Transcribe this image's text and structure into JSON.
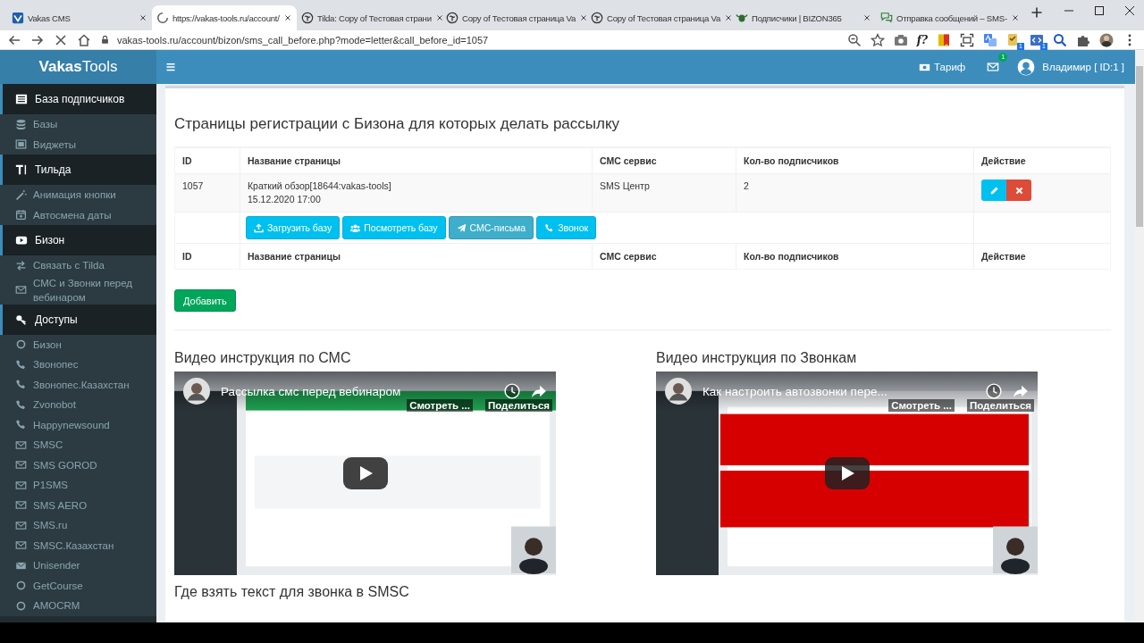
{
  "browser": {
    "tabs": [
      {
        "title": "Vakas CMS",
        "kind": "vakas",
        "selected": false
      },
      {
        "title": "https://vakas-tools.ru/account/",
        "kind": "loading",
        "selected": true
      },
      {
        "title": "Tilda: Copy of Тестовая страни",
        "kind": "tilda",
        "selected": false
      },
      {
        "title": "Copy of Тестовая страница Va",
        "kind": "tilda",
        "selected": false
      },
      {
        "title": "Copy of Тестовая страница Va",
        "kind": "tilda",
        "selected": false
      },
      {
        "title": "Подписчики | BIZON365",
        "kind": "bizon",
        "selected": false
      },
      {
        "title": "Отправка сообщений – SMS-",
        "kind": "chat",
        "selected": false
      }
    ],
    "url": "vakas-tools.ru/account/bizon/sms_call_before.php?mode=letter&call_before_id=1057",
    "extensions": [
      {
        "kind": "camera"
      },
      {
        "kind": "label",
        "label": "f?"
      },
      {
        "kind": "flag"
      },
      {
        "kind": "screen"
      },
      {
        "kind": "translate"
      },
      {
        "kind": "check",
        "badge": "1"
      },
      {
        "kind": "code",
        "badge": "1"
      },
      {
        "kind": "search"
      },
      {
        "kind": "puzzle"
      },
      {
        "kind": "avatar"
      }
    ]
  },
  "header": {
    "logo": "**Vakas**Tools",
    "tariff": "Тариф",
    "mail_badge": "1",
    "user": "Владимир [ ID:1 ]"
  },
  "sidebar": {
    "sections": [
      {
        "title": "База подписчиков",
        "kind": "list",
        "items": [
          {
            "label": "Базы",
            "kind": "database"
          },
          {
            "label": "Виджеты",
            "kind": "widget"
          }
        ]
      },
      {
        "title": "Тильда",
        "kind": "text",
        "items": [
          {
            "label": "Анимация кнопки",
            "kind": "wand"
          },
          {
            "label": "Автосмена даты",
            "kind": "calendar"
          }
        ]
      },
      {
        "title": "Бизон",
        "kind": "youtube",
        "items": [
          {
            "label": "Связать с Tilda",
            "kind": "exchange"
          },
          {
            "label": "СМС и Звонки перед вебинаром",
            "kind": "mail"
          }
        ]
      },
      {
        "title": "Доступы",
        "kind": "key",
        "items": [
          {
            "label": "Бизон",
            "kind": "circle"
          },
          {
            "label": "Звонопес",
            "kind": "phone"
          },
          {
            "label": "Звонопес.Казахстан",
            "kind": "phone"
          },
          {
            "label": "Zvonobot",
            "kind": "phone"
          },
          {
            "label": "Happynewsound",
            "kind": "phone"
          },
          {
            "label": "SMSC",
            "kind": "mail"
          },
          {
            "label": "SMS GOROD",
            "kind": "mail"
          },
          {
            "label": "P1SMS",
            "kind": "mail"
          },
          {
            "label": "SMS AERO",
            "kind": "mail"
          },
          {
            "label": "SMS.ru",
            "kind": "mail"
          },
          {
            "label": "SMSC.Казахстан",
            "kind": "mail"
          },
          {
            "label": "Unisender",
            "kind": "envelope"
          },
          {
            "label": "GetCourse",
            "kind": "circle"
          },
          {
            "label": "AMOCRM",
            "kind": "circle"
          }
        ]
      }
    ]
  },
  "page": {
    "title": "Страницы регистрации с Бизона для которых делать рассылку",
    "table": {
      "columns": [
        "ID",
        "Название страницы",
        "СМС сервис",
        "Кол-во подписчиков",
        "Действие"
      ],
      "rows": [
        {
          "id": "1057",
          "page_name": "Краткий обзор[18644:vakas-tools]",
          "date": "15.12.2020 17:00",
          "service": "SMS Центр",
          "count": "2"
        }
      ],
      "row_buttons": [
        {
          "label": "Загрузить базу",
          "kind": "upload",
          "selected": false
        },
        {
          "label": "Посмотреть базу",
          "kind": "users",
          "selected": false
        },
        {
          "label": "СМС-письма",
          "kind": "send",
          "selected": true
        },
        {
          "label": "Звонок",
          "kind": "phone",
          "selected": false
        }
      ],
      "footer_columns": [
        "ID",
        "Название страницы",
        "СМС сервис",
        "Кол-во подписчиков",
        "Действие"
      ]
    },
    "add_button": "Добавить",
    "videos": [
      {
        "heading": "Видео инструкция по СМС",
        "title": "Рассылка смс перед вебинаром",
        "watch": "Смотреть ...",
        "share": "Поделиться",
        "kind": "green"
      },
      {
        "heading": "Видео инструкция по Звонкам",
        "title": "Как настроить автозвонки пере...",
        "watch": "Смотреть ...",
        "share": "Поделиться",
        "kind": "red"
      }
    ],
    "next_heading": "Где взять текст для звонка в SMSC"
  }
}
